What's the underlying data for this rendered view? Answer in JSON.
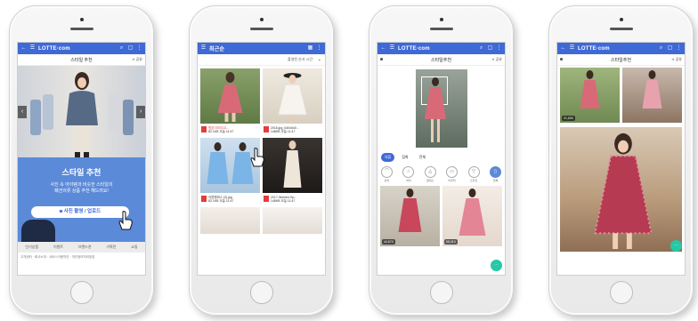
{
  "phone1": {
    "logo": "LOTTE·com",
    "title": "스타일 추천",
    "share": "공유",
    "promo_title": "스타일 추천",
    "promo_desc_1": "사진 속 아이템과 비슷한 스타일의",
    "promo_desc_2": "패션의류 상품 추천 해드려요!",
    "button_label": "사진 촬영 / 업로드",
    "nav": [
      "인기상품",
      "이벤트",
      "브랜드관",
      "기획전",
      "쇼핑"
    ],
    "footer": "고객센터 · 회사소개 · 서비스이용약관 · 개인정보처리방침"
  },
  "phone2": {
    "title": "최근순",
    "filter": "촬영된 순서 시간",
    "items": [
      {
        "name": "원본이미지13...",
        "meta": "82.1KB 오늘 11:47"
      },
      {
        "name": "2018.jpg_640x640...",
        "meta": "148KB 오늘 11:47"
      },
      {
        "name": "이쁜원피스 (2).jpg",
        "meta": "82.1KB 오늘 11:47"
      },
      {
        "name": "2017-Women-Sp...",
        "meta": "148KB 오늘 11:47"
      }
    ]
  },
  "phone3": {
    "logo": "LOTTE·com",
    "title": "스타일추천",
    "share": "공유",
    "tabs": [
      "의류",
      "잡화",
      "전체"
    ],
    "categories": [
      "상의",
      "하의",
      "원피스",
      "아우터",
      "스커트",
      "전체"
    ],
    "counts": [
      "44,670",
      "58,010"
    ],
    "fab": "···"
  },
  "phone4": {
    "logo": "LOTTE·com",
    "title": "스타일추천",
    "share": "공유",
    "counts": [
      "21,630"
    ],
    "fab": "···"
  },
  "colors": {
    "brand": "#3f69d6",
    "promo": "#5b8ad8",
    "accent": "#25c9a6"
  }
}
